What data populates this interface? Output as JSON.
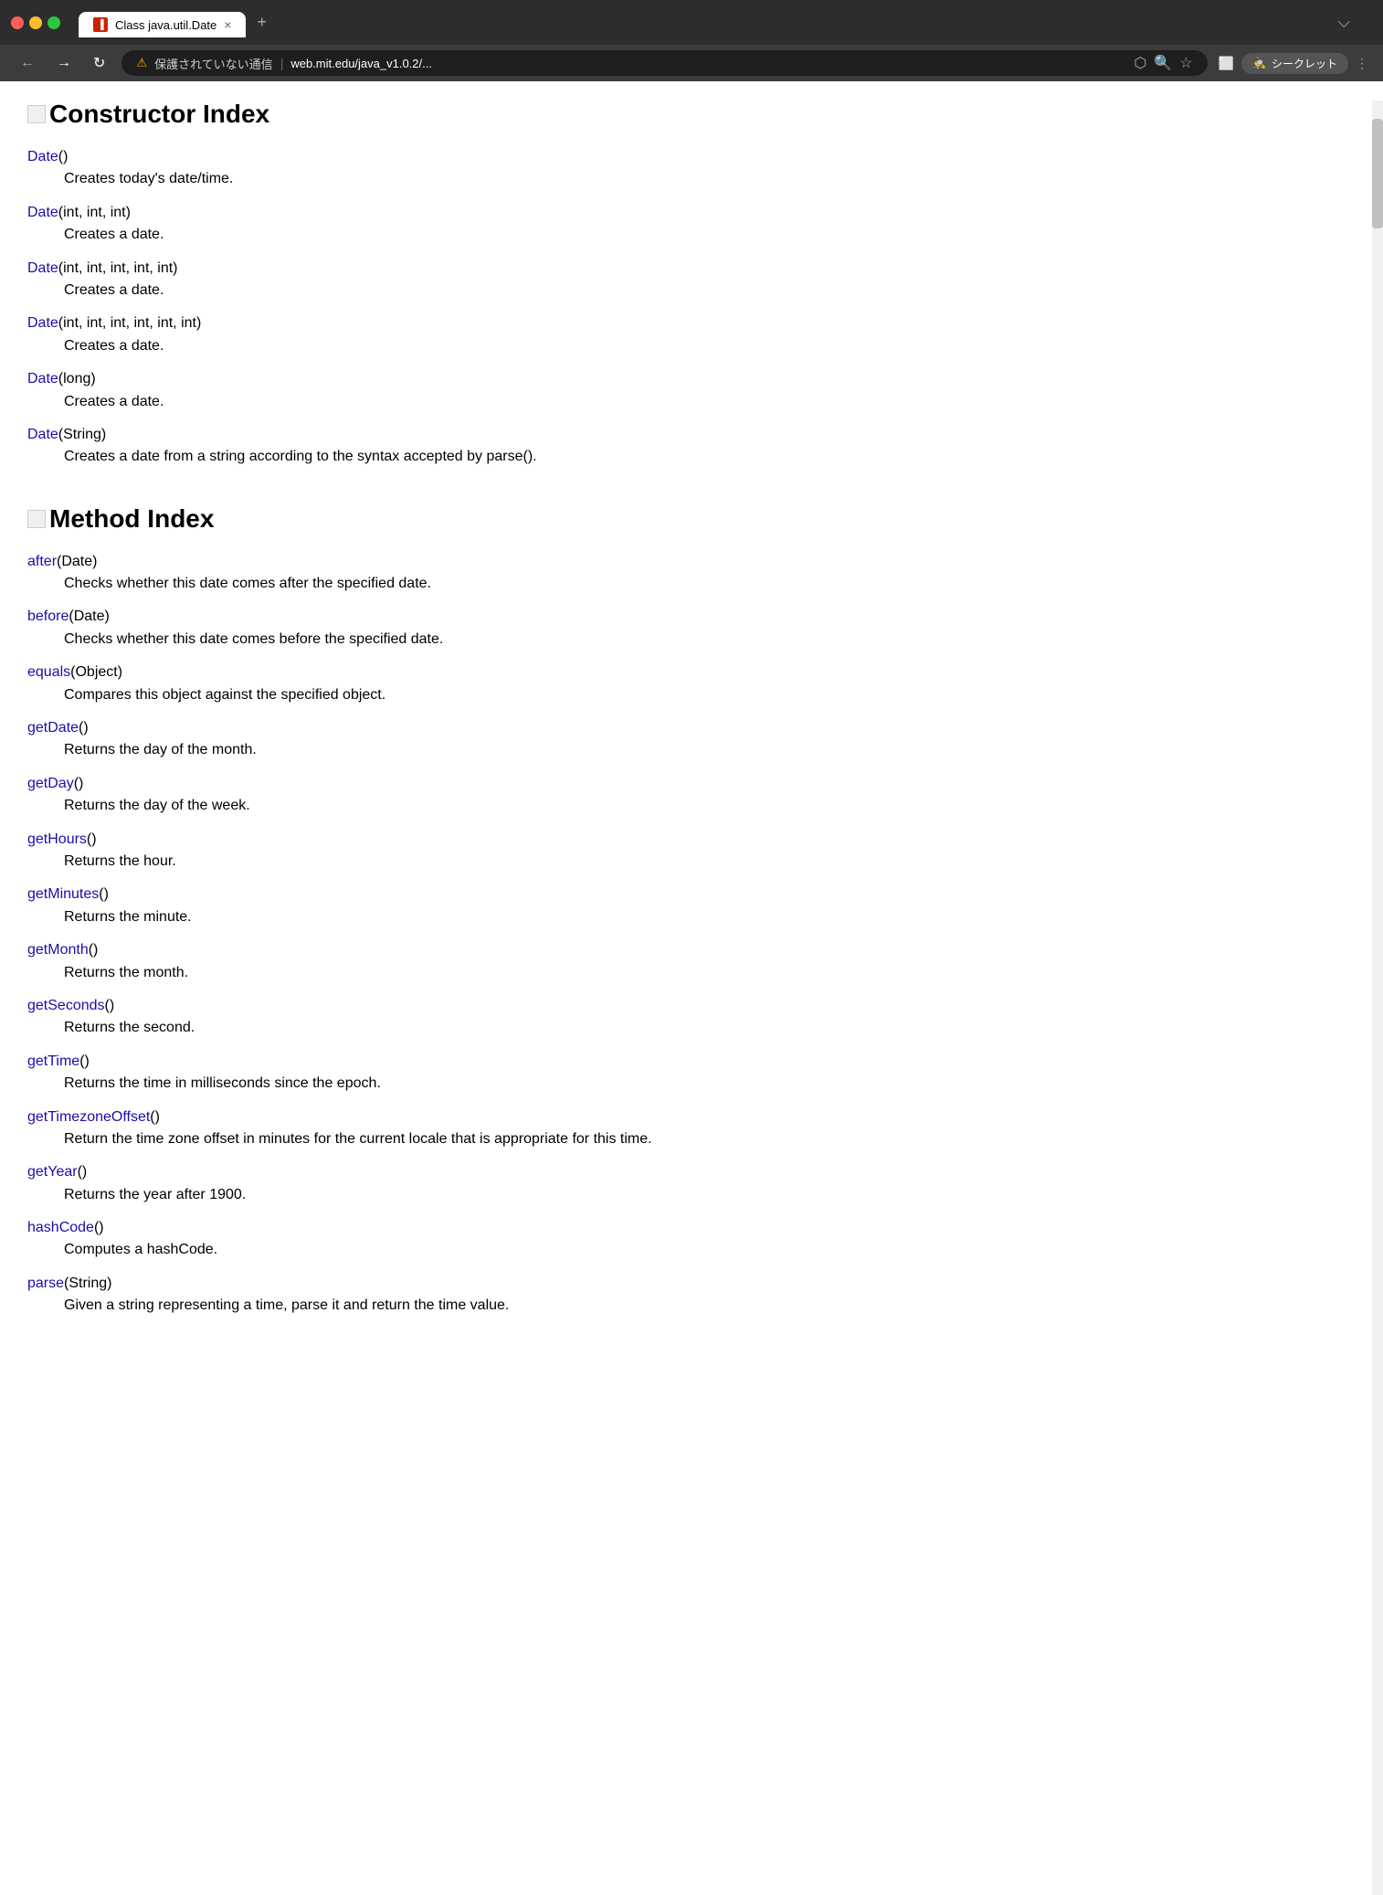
{
  "browser": {
    "title": "Class java.util.Date",
    "url_warning": "保護されていない通信",
    "url": "web.mit.edu/java_v1.0.2/...",
    "secret_label": "シークレット",
    "tab_close": "×",
    "tab_new": "+",
    "more_tabs": "⌵"
  },
  "page": {
    "constructor_index": {
      "title": "Constructor Index",
      "entries": [
        {
          "link": "Date",
          "params": "()",
          "description": "Creates today's date/time."
        },
        {
          "link": "Date",
          "params": "(int, int, int)",
          "description": "Creates a date."
        },
        {
          "link": "Date",
          "params": "(int, int, int, int, int)",
          "description": "Creates a date."
        },
        {
          "link": "Date",
          "params": "(int, int, int, int, int, int)",
          "description": "Creates a date."
        },
        {
          "link": "Date",
          "params": "(long)",
          "description": "Creates a date."
        },
        {
          "link": "Date",
          "params": "(String)",
          "description": "Creates a date from a string according to the syntax accepted by parse()."
        }
      ]
    },
    "method_index": {
      "title": "Method Index",
      "entries": [
        {
          "link": "after",
          "params": "(Date)",
          "description": "Checks whether this date comes after the specified date."
        },
        {
          "link": "before",
          "params": "(Date)",
          "description": "Checks whether this date comes before the specified date."
        },
        {
          "link": "equals",
          "params": "(Object)",
          "description": "Compares this object against the specified object."
        },
        {
          "link": "getDate",
          "params": "()",
          "description": "Returns the day of the month."
        },
        {
          "link": "getDay",
          "params": "()",
          "description": "Returns the day of the week."
        },
        {
          "link": "getHours",
          "params": "()",
          "description": "Returns the hour."
        },
        {
          "link": "getMinutes",
          "params": "()",
          "description": "Returns the minute."
        },
        {
          "link": "getMonth",
          "params": "()",
          "description": "Returns the month."
        },
        {
          "link": "getSeconds",
          "params": "()",
          "description": "Returns the second."
        },
        {
          "link": "getTime",
          "params": "()",
          "description": "Returns the time in milliseconds since the epoch."
        },
        {
          "link": "getTimezoneOffset",
          "params": "()",
          "description": "Return the time zone offset in minutes for the current locale that is appropriate for this time."
        },
        {
          "link": "getYear",
          "params": "()",
          "description": "Returns the year after 1900."
        },
        {
          "link": "hashCode",
          "params": "()",
          "description": "Computes a hashCode."
        },
        {
          "link": "parse",
          "params": "(String)",
          "description": "Given a string representing a time, parse it and return the time value."
        }
      ]
    }
  }
}
